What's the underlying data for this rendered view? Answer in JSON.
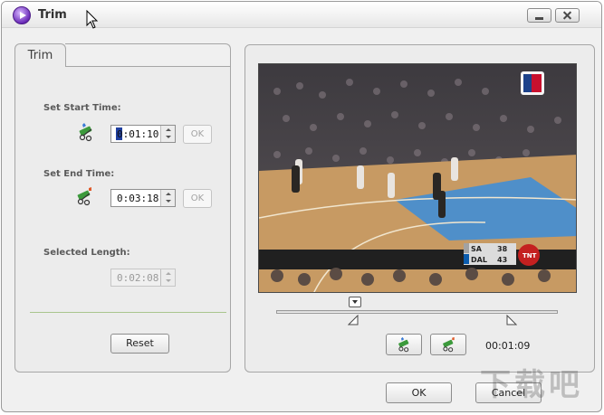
{
  "window": {
    "title": "Trim"
  },
  "left_panel": {
    "tab_label": "Trim",
    "start": {
      "label": "Set Start Time:",
      "time": "0:01:10",
      "ok_label": "OK"
    },
    "end": {
      "label": "Set End Time:",
      "time": "0:03:18",
      "ok_label": "OK"
    },
    "length": {
      "label": "Selected Length:",
      "time": "0:02:08"
    },
    "reset_label": "Reset"
  },
  "preview": {
    "channel_logo": "NBA TV",
    "scoreboard": {
      "team1": "SA",
      "score1": "38",
      "team2": "DAL",
      "score2": "43",
      "network": "TNT"
    },
    "timeline_position": 0.28,
    "start_marker_position": 0.28,
    "end_marker_position": 0.83,
    "current_time": "00:01:09",
    "set_start_button_icon": "clip-start-icon",
    "set_end_button_icon": "clip-end-icon"
  },
  "footer": {
    "ok_label": "OK",
    "cancel_label": "Cancel"
  },
  "watermark": {
    "text": "下载吧"
  },
  "colors": {
    "window_bg": "#f0f0f0",
    "divider": "#a9c58d",
    "caret": "#1f3f9f"
  }
}
